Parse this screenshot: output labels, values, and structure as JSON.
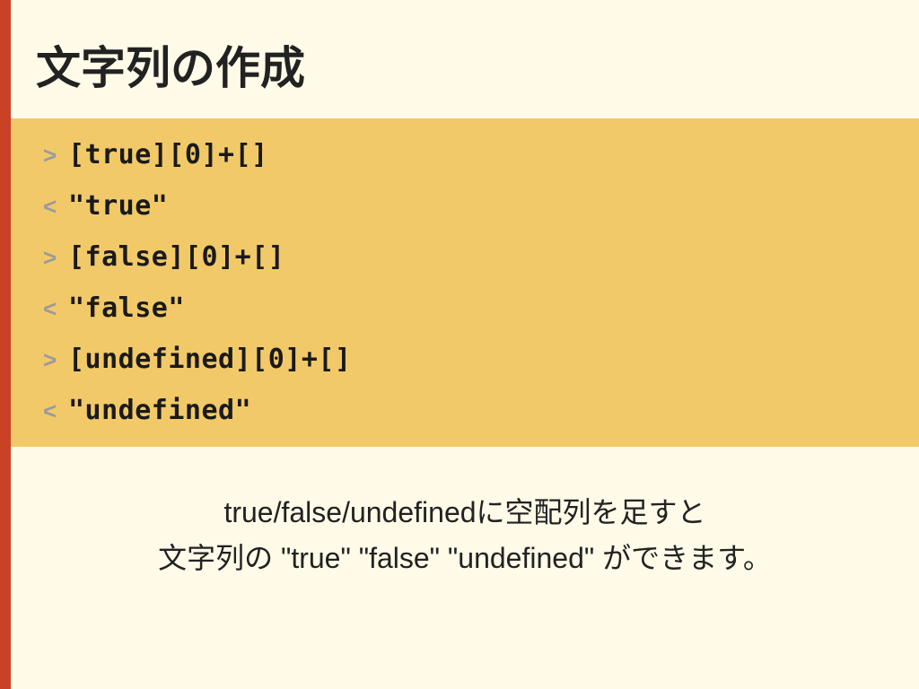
{
  "title": "文字列の作成",
  "code_lines": [
    {
      "dir": ">",
      "text": "[true][0]+[]"
    },
    {
      "dir": "<",
      "text": "\"true\""
    },
    {
      "dir": ">",
      "text": "[false][0]+[]"
    },
    {
      "dir": "<",
      "text": "\"false\""
    },
    {
      "dir": ">",
      "text": "[undefined][0]+[]"
    },
    {
      "dir": "<",
      "text": "\"undefined\""
    }
  ],
  "caption_line1": "true/false/undefinedに空配列を足すと",
  "caption_line2": "文字列の \"true\" \"false\" \"undefined\" ができます。"
}
